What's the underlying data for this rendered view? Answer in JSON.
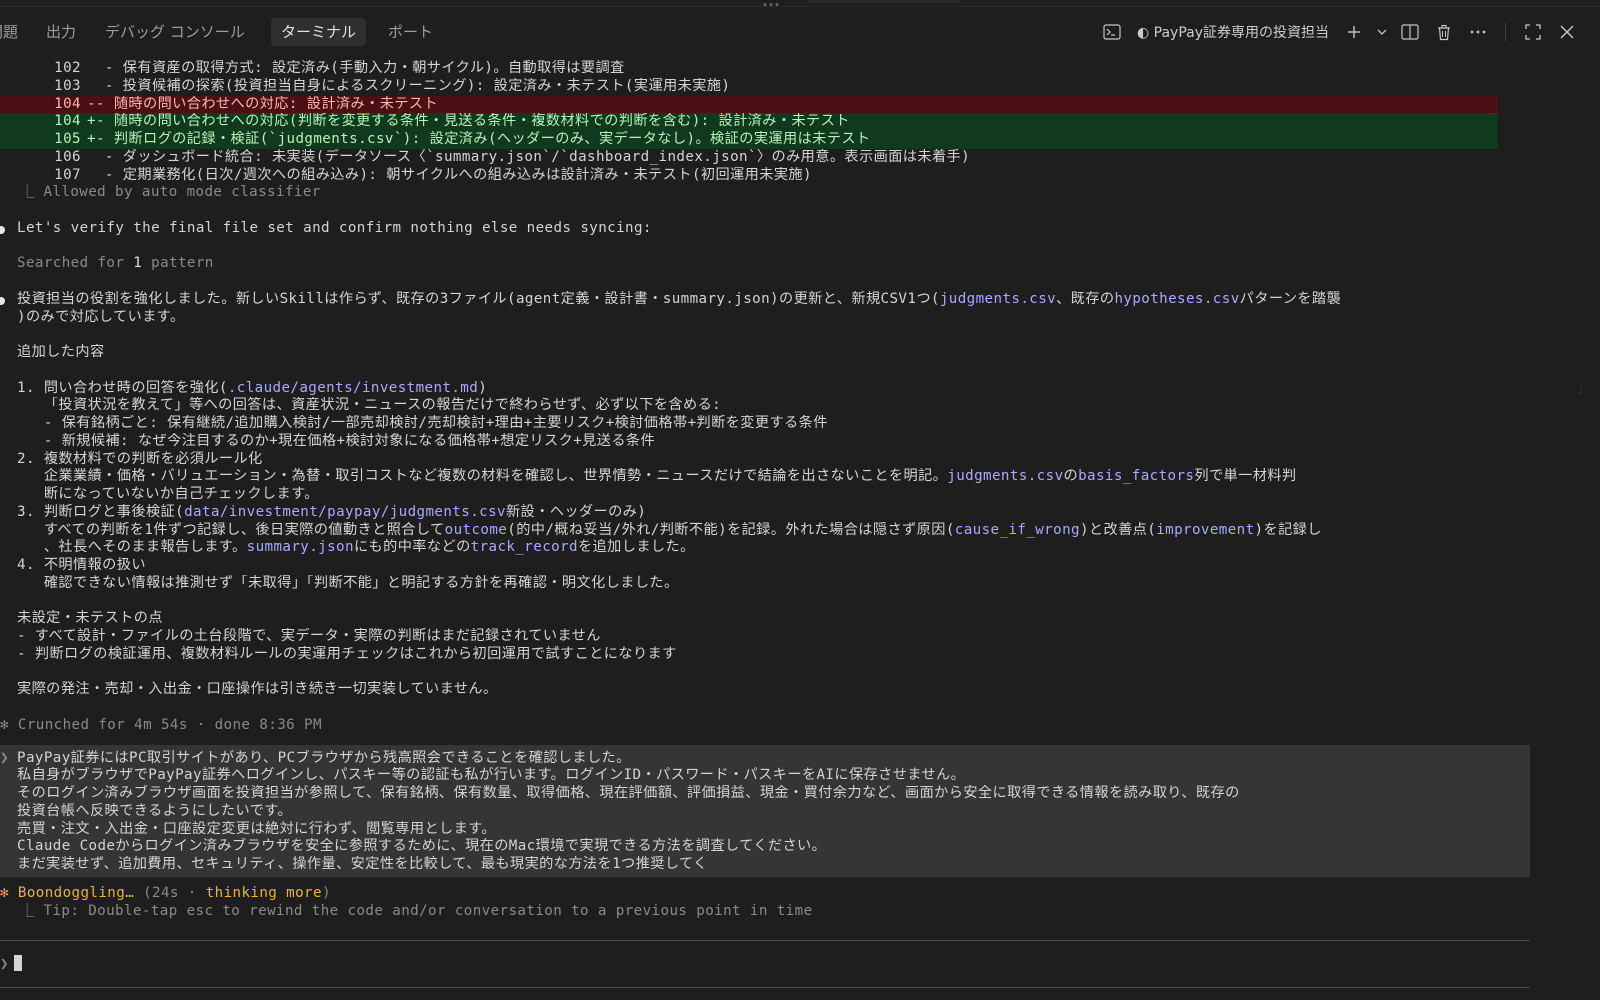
{
  "panel": {
    "tabs": [
      {
        "label": "問題"
      },
      {
        "label": "出力"
      },
      {
        "label": "デバッグ コンソール"
      },
      {
        "label": "ターミナル"
      },
      {
        "label": "ポート"
      }
    ],
    "terminal_title": "◐ PayPay証券専用の投資担当"
  },
  "diff": [
    {
      "num": "102",
      "sign": " ",
      "text": "- 保有資産の取得方式: 設定済み(手動入力・朝サイクル)。自動取得は要調査"
    },
    {
      "num": "103",
      "sign": " ",
      "text": "- 投資候補の探索(投資担当自身によるスクリーニング): 設定済み・未テスト(実運用未実施)"
    },
    {
      "num": "104",
      "sign": "-",
      "text": "- 随時の問い合わせへの対応: 設計済み・未テスト"
    },
    {
      "num": "104",
      "sign": "+",
      "text": "- 随時の問い合わせへの対応(判断を変更する条件・見送る条件・複数材料での判断を含む): 設計済み・未テスト"
    },
    {
      "num": "105",
      "sign": "+",
      "text": "- 判断ログの記録・検証(`judgments.csv`): 設定済み(ヘッダーのみ、実データなし)。検証の実運用は未テスト"
    },
    {
      "num": "106",
      "sign": " ",
      "text": "- ダッシュボード統合: 未実装(データソース〈`summary.json`/`dashboard_index.json`〉のみ用意。表示画面は未着手)"
    },
    {
      "num": "107",
      "sign": " ",
      "text": "- 定期業務化(日次/週次への組み込み): 朝サイクルへの組み込みは設計済み・未テスト(初回運用未実施)"
    }
  ],
  "allowed": "⎿ Allowed by auto mode classifier",
  "verify_msg": "Let's verify the final file set and confirm nothing else needs syncing:",
  "searched_a": "Searched for ",
  "searched_b": "1",
  "searched_c": " pattern",
  "summary": {
    "l1a": "投資担当の役割を強化しました。新しいSkillは作らず、既存の3ファイル(agent定義・設計書・summary.json)の更新と、新規CSV1つ(",
    "l1b": "judgments.csv",
    "l1c": "、既存の",
    "l1d": "hypotheses.csv",
    "l1e": "パターンを踏襲",
    "l2": ")のみで対応しています。",
    "heading": "追加した内容",
    "i1a": "1. 問い合わせ時の回答を強化(",
    "i1b": ".claude/agents/investment.md",
    "i1c": ")",
    "i1d": "   「投資状況を教えて」等への回答は、資産状況・ニュースの報告だけで終わらせず、必ず以下を含める:",
    "i1e": "   - 保有銘柄ごと: 保有継続/追加購入検討/一部売却検討/売却検討+理由+主要リスク+検討価格帯+判断を変更する条件",
    "i1f": "   - 新規候補: なぜ今注目するのか+現在価格+検討対象になる価格帯+想定リスク+見送る条件",
    "i2a": "2. 複数材料での判断を必須ルール化",
    "i2b": "   企業業績・価格・バリュエーション・為替・取引コストなど複数の材料を確認し、世界情勢・ニュースだけで結論を出さないことを明記。",
    "i2c": "judgments.csv",
    "i2d": "の",
    "i2e": "basis_factors",
    "i2f": "列で単一材料判",
    "i2g": "   断になっていないか自己チェックします。",
    "i3a": "3. 判断ログと事後検証(",
    "i3b": "data/investment/paypay/judgments.csv",
    "i3c": "新設・ヘッダーのみ)",
    "i3d": "   すべての判断を1件ずつ記録し、後日実際の値動きと照合して",
    "i3e": "outcome",
    "i3f": "(的中/概ね妥当/外れ/判断不能)を記録。外れた場合は隠さず原因(",
    "i3g": "cause_if_wrong",
    "i3h": ")と改善点(",
    "i3i": "improvement",
    "i3j": ")を記録し",
    "i3k": "   、社長へそのまま報告します。",
    "i3l": "summary.json",
    "i3m": "にも的中率などの",
    "i3n": "track_record",
    "i3o": "を追加しました。",
    "i4a": "4. 不明情報の扱い",
    "i4b": "   確認できない情報は推測せず「未取得」「判断不能」と明記する方針を再確認・明文化しました。",
    "pending_heading": "未設定・未テストの点",
    "p1": "- すべて設計・ファイルの土台段階で、実データ・実際の判断はまだ記録されていません",
    "p2": "- 判断ログの検証運用、複数材料ルールの実運用チェックはこれから初回運用で試すことになります",
    "closing": "実際の発注・売却・入出金・口座操作は引き続き一切実装していません。"
  },
  "crunched": "✻ Crunched for 4m 54s · done 8:36 PM",
  "prompt_lines": [
    "PayPay証券にはPC取引サイトがあり、PCブラウザから残高照会できることを確認しました。",
    "私自身がブラウザでPayPay証券へログインし、パスキー等の認証も私が行います。ログインID・パスワード・パスキーをAIに保存させません。",
    "そのログイン済みブラウザ画面を投資担当が参照して、保有銘柄、保有数量、取得価格、現在評価額、評価損益、現金・買付余力など、画面から安全に取得できる情報を読み取り、既存の",
    "投資台帳へ反映できるようにしたいです。",
    "売買・注文・入出金・口座設定変更は絶対に行わず、閲覧専用とします。",
    "Claude Codeからログイン済みブラウザを安全に参照するために、現在のMac環境で実現できる方法を調査してください。",
    "まだ実装せず、追加費用、セキュリティ、操作量、安定性を比較して、最も現実的な方法を1つ推奨してく"
  ],
  "status": {
    "star": "✻ ",
    "word": "Boondoggling…",
    "paren_open": " (24s · ",
    "thinking": "thinking more",
    "paren_close": ")"
  },
  "tip": "⎿ Tip: Double-tap esc to rewind the code and/or conversation to a previous point in time",
  "input_prompt": "❯"
}
